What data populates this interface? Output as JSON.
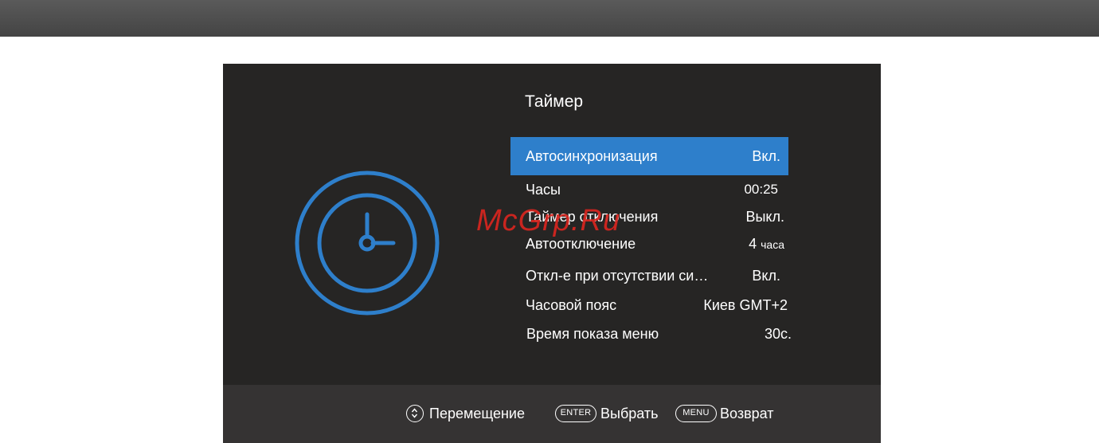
{
  "menu": {
    "title": "Таймер",
    "items": [
      {
        "label": "Автосинхронизация",
        "value": "Вкл.",
        "selected": true
      },
      {
        "label": "Часы",
        "value": "00:25",
        "selected": false
      },
      {
        "label": "Таймер отключения",
        "value": "Выкл.",
        "selected": false
      },
      {
        "label": "Автоотключение",
        "value": "4",
        "value_unit": "часа",
        "selected": false
      },
      {
        "label": "Откл-е при отсутствии си…",
        "value": "Вкл.",
        "selected": false
      },
      {
        "label": "Часовой пояс",
        "value": "Киев GMT+2",
        "selected": false
      },
      {
        "label": "Время показа меню",
        "value": "30с.",
        "selected": false
      }
    ]
  },
  "footer": {
    "move_label": "Перемещение",
    "enter_key": "ENTER",
    "select_label": "Выбрать",
    "menu_key": "MENU",
    "back_label": "Возврат"
  },
  "watermark": "McGrp.Ru",
  "icons": {
    "left_graphic": "clock-icon",
    "move_hint": "up-down-arrows-icon"
  },
  "colors": {
    "accent": "#2e7fcb",
    "background": "#262524",
    "footer": "#353333",
    "watermark": "#d8251f"
  }
}
